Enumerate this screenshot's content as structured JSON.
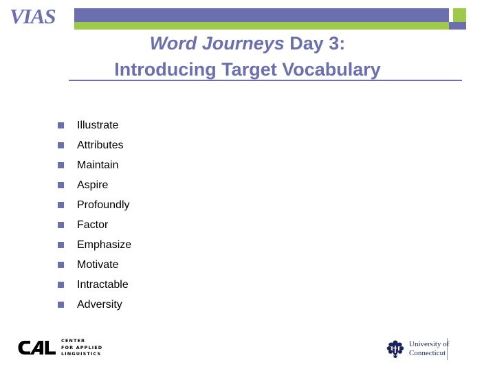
{
  "header": {
    "logo_text": "VIAS",
    "bar_purple_color": "#6b6fb0",
    "bar_green_color": "#9ec94a"
  },
  "title": {
    "line1_italic": "Word Journeys",
    "line1_rest": " Day 3:",
    "line2": "Introducing Target Vocabulary",
    "color": "#6b6fb0"
  },
  "vocab": {
    "items": [
      {
        "label": "Illustrate"
      },
      {
        "label": "Attributes"
      },
      {
        "label": "Maintain"
      },
      {
        "label": "Aspire"
      },
      {
        "label": "Profoundly"
      },
      {
        "label": "Factor"
      },
      {
        "label": "Emphasize"
      },
      {
        "label": "Motivate"
      },
      {
        "label": "Intractable"
      },
      {
        "label": "Adversity"
      }
    ],
    "bullet_color": "#6b6fb0"
  },
  "footer": {
    "cal": {
      "mark_text": "CAL",
      "line1": "Center",
      "line2": "for Applied",
      "line3": "Linguistics"
    },
    "uconn": {
      "line1": "University of",
      "line2": "Connecticut",
      "seal_icon": "oak-crest-icon",
      "color": "#1b2159"
    }
  }
}
